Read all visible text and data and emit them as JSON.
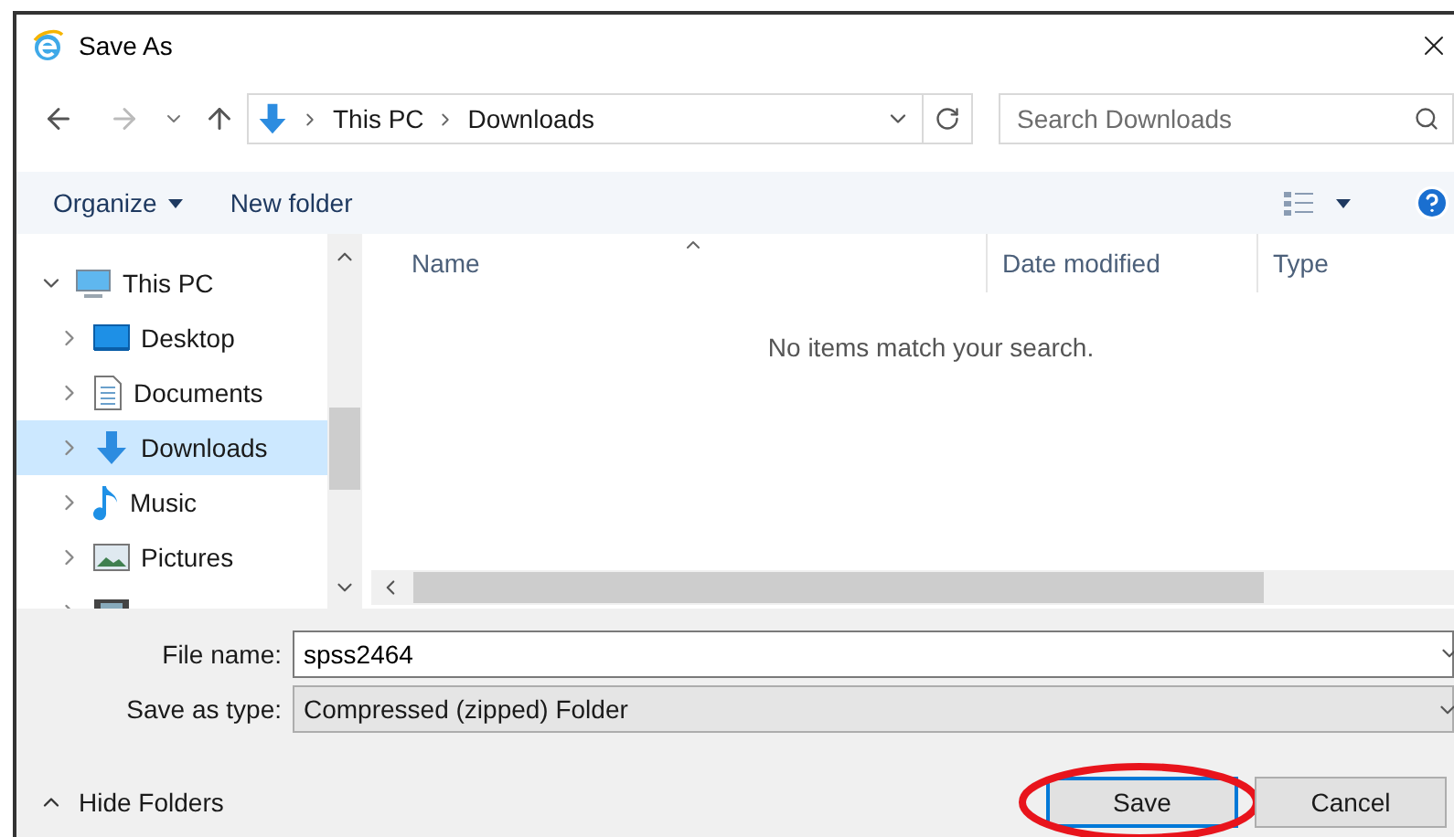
{
  "window": {
    "title": "Save As"
  },
  "address_bar": {
    "path": [
      "This PC",
      "Downloads"
    ]
  },
  "search": {
    "placeholder": "Search Downloads"
  },
  "toolbar": {
    "buttons": [
      {
        "label": "Organize",
        "dropdown": true
      },
      {
        "label": "New folder",
        "dropdown": false
      }
    ]
  },
  "nav": {
    "items": [
      {
        "label": "This PC",
        "kind": "pc",
        "expanded": true,
        "selected": false,
        "children": [
          {
            "label": "Desktop",
            "kind": "desktop",
            "expanded": false,
            "selected": false
          },
          {
            "label": "Documents",
            "kind": "documents",
            "expanded": false,
            "selected": false
          },
          {
            "label": "Downloads",
            "kind": "downloads",
            "expanded": false,
            "selected": true
          },
          {
            "label": "Music",
            "kind": "music",
            "expanded": false,
            "selected": false
          },
          {
            "label": "Pictures",
            "kind": "pictures",
            "expanded": false,
            "selected": false
          },
          {
            "kind": "videos",
            "expanded": false,
            "selected": false
          }
        ]
      }
    ]
  },
  "columns": [
    {
      "label": "Name",
      "sorted": true
    },
    {
      "label": "Date modified",
      "sorted": false
    },
    {
      "label": "Type",
      "sorted": false
    }
  ],
  "empty_message": "No items match your search.",
  "fields": [
    {
      "label": "File name:",
      "value": "spss2464",
      "kind": "text"
    },
    {
      "label": "Save as type:",
      "value": "Compressed (zipped) Folder",
      "kind": "select"
    }
  ],
  "hide_folders": "Hide Folders",
  "buttons": [
    {
      "label": "Save",
      "default": true,
      "highlighted": true
    },
    {
      "label": "Cancel",
      "default": false,
      "highlighted": false
    }
  ]
}
